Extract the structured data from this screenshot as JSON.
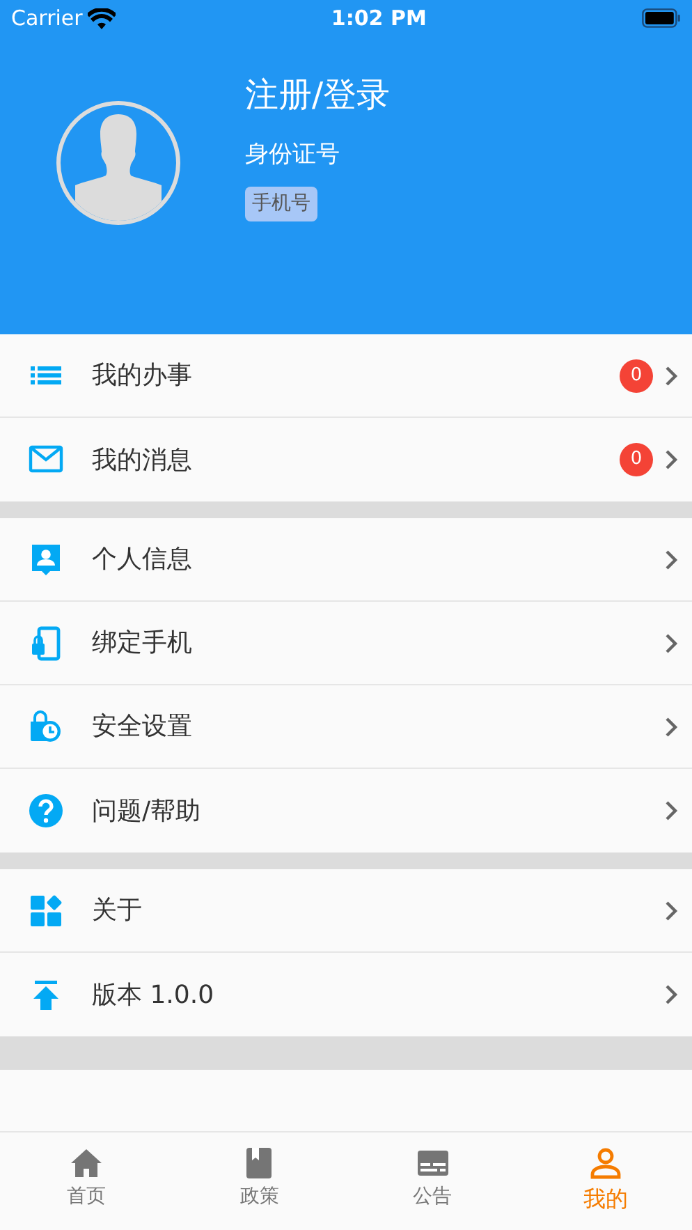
{
  "status_bar": {
    "carrier": "Carrier",
    "time": "1:02 PM"
  },
  "profile": {
    "title": "注册/登录",
    "id_label": "身份证号",
    "phone_tag": "手机号"
  },
  "menu_groups": [
    {
      "items": [
        {
          "label": "我的办事",
          "badge": "0"
        },
        {
          "label": "我的消息",
          "badge": "0"
        }
      ]
    },
    {
      "items": [
        {
          "label": "个人信息"
        },
        {
          "label": "绑定手机"
        },
        {
          "label": "安全设置"
        },
        {
          "label": "问题/帮助"
        }
      ]
    },
    {
      "items": [
        {
          "label": "关于"
        },
        {
          "label": "版本 1.0.0"
        }
      ]
    }
  ],
  "tabs": [
    {
      "label": "首页",
      "selected": false
    },
    {
      "label": "政策",
      "selected": false
    },
    {
      "label": "公告",
      "selected": false
    },
    {
      "label": "我的",
      "selected": true
    }
  ]
}
